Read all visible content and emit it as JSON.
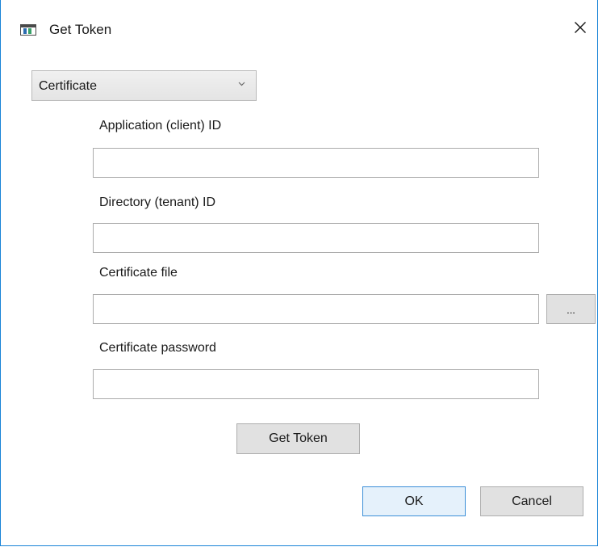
{
  "window": {
    "title": "Get Token"
  },
  "auth_method": {
    "selected": "Certificate"
  },
  "form": {
    "client_id": {
      "label": "Application (client) ID",
      "value": ""
    },
    "tenant_id": {
      "label": "Directory (tenant) ID",
      "value": ""
    },
    "certificate_file": {
      "label": "Certificate file",
      "value": "",
      "browse_label": "..."
    },
    "certificate_password": {
      "label": "Certificate password",
      "value": ""
    }
  },
  "actions": {
    "get_token_label": "Get Token",
    "ok_label": "OK",
    "cancel_label": "Cancel"
  },
  "colors": {
    "window_border": "#1883d7",
    "default_button_border": "#3c8fd8",
    "button_background": "#e1e1e1"
  }
}
